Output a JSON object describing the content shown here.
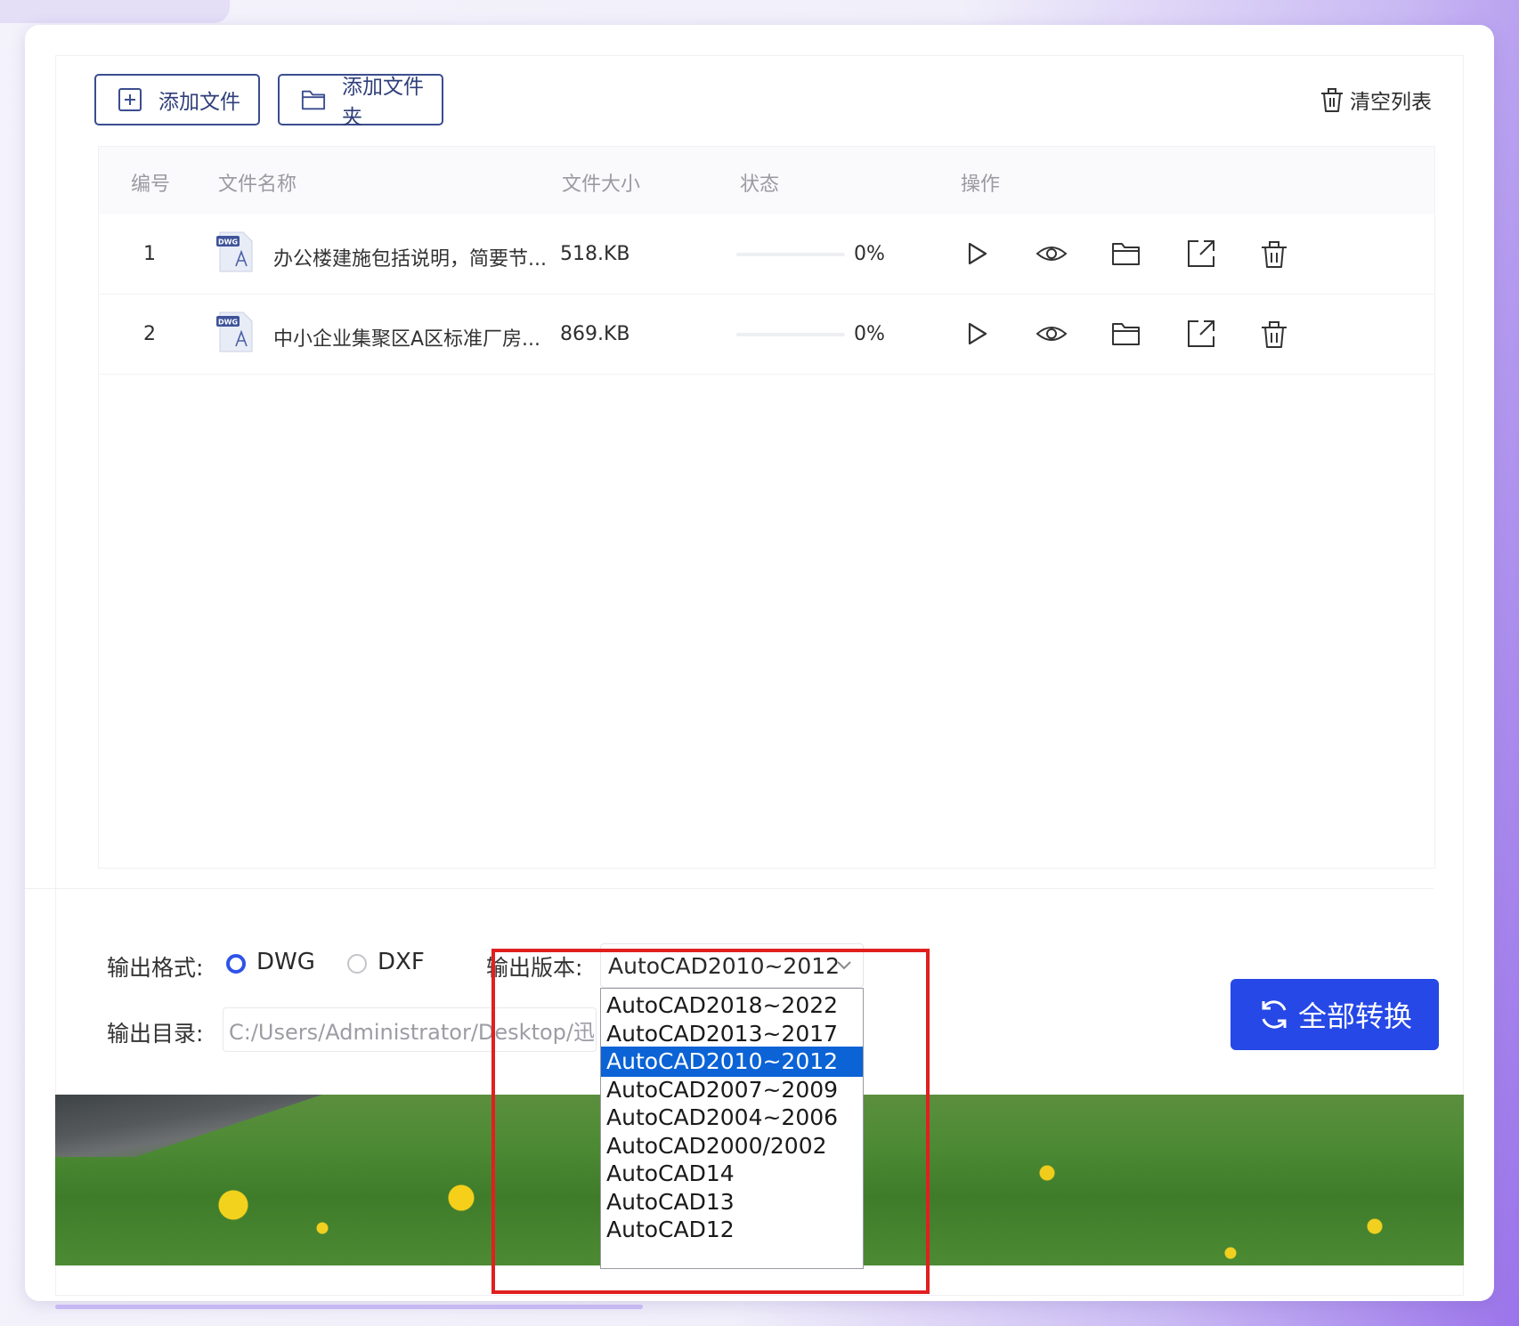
{
  "toolbar": {
    "add_file": "添加文件",
    "add_folder": "添加文件夹",
    "clear_list": "清空列表"
  },
  "table": {
    "columns": [
      "编号",
      "文件名称",
      "文件大小",
      "状态",
      "操作"
    ],
    "rows": [
      {
        "num": "1",
        "name": "办公楼建施包括说明，简要节...",
        "size": "518.KB",
        "progress": 0,
        "progress_text": "0%"
      },
      {
        "num": "2",
        "name": "中小企业集聚区A区标准厂房...",
        "size": "869.KB",
        "progress": 0,
        "progress_text": "0%"
      }
    ]
  },
  "settings": {
    "format_label": "输出格式:",
    "format_options": [
      "DWG",
      "DXF"
    ],
    "format_selected": "DWG",
    "version_label": "输出版本:",
    "version_selected": "AutoCAD2010~2012",
    "version_options": [
      "AutoCAD2018~2022",
      "AutoCAD2013~2017",
      "AutoCAD2010~2012",
      "AutoCAD2007~2009",
      "AutoCAD2004~2006",
      "AutoCAD2000/2002",
      "AutoCAD14",
      "AutoCAD13",
      "AutoCAD12"
    ],
    "dir_label": "输出目录:",
    "dir_value": "C:/Users/Administrator/Desktop/迅..."
  },
  "convert_all": "全部转换",
  "colors": {
    "accent_blue": "#2648e6",
    "highlight_red": "#e0201f",
    "dropdown_selected": "#0b63d6"
  }
}
